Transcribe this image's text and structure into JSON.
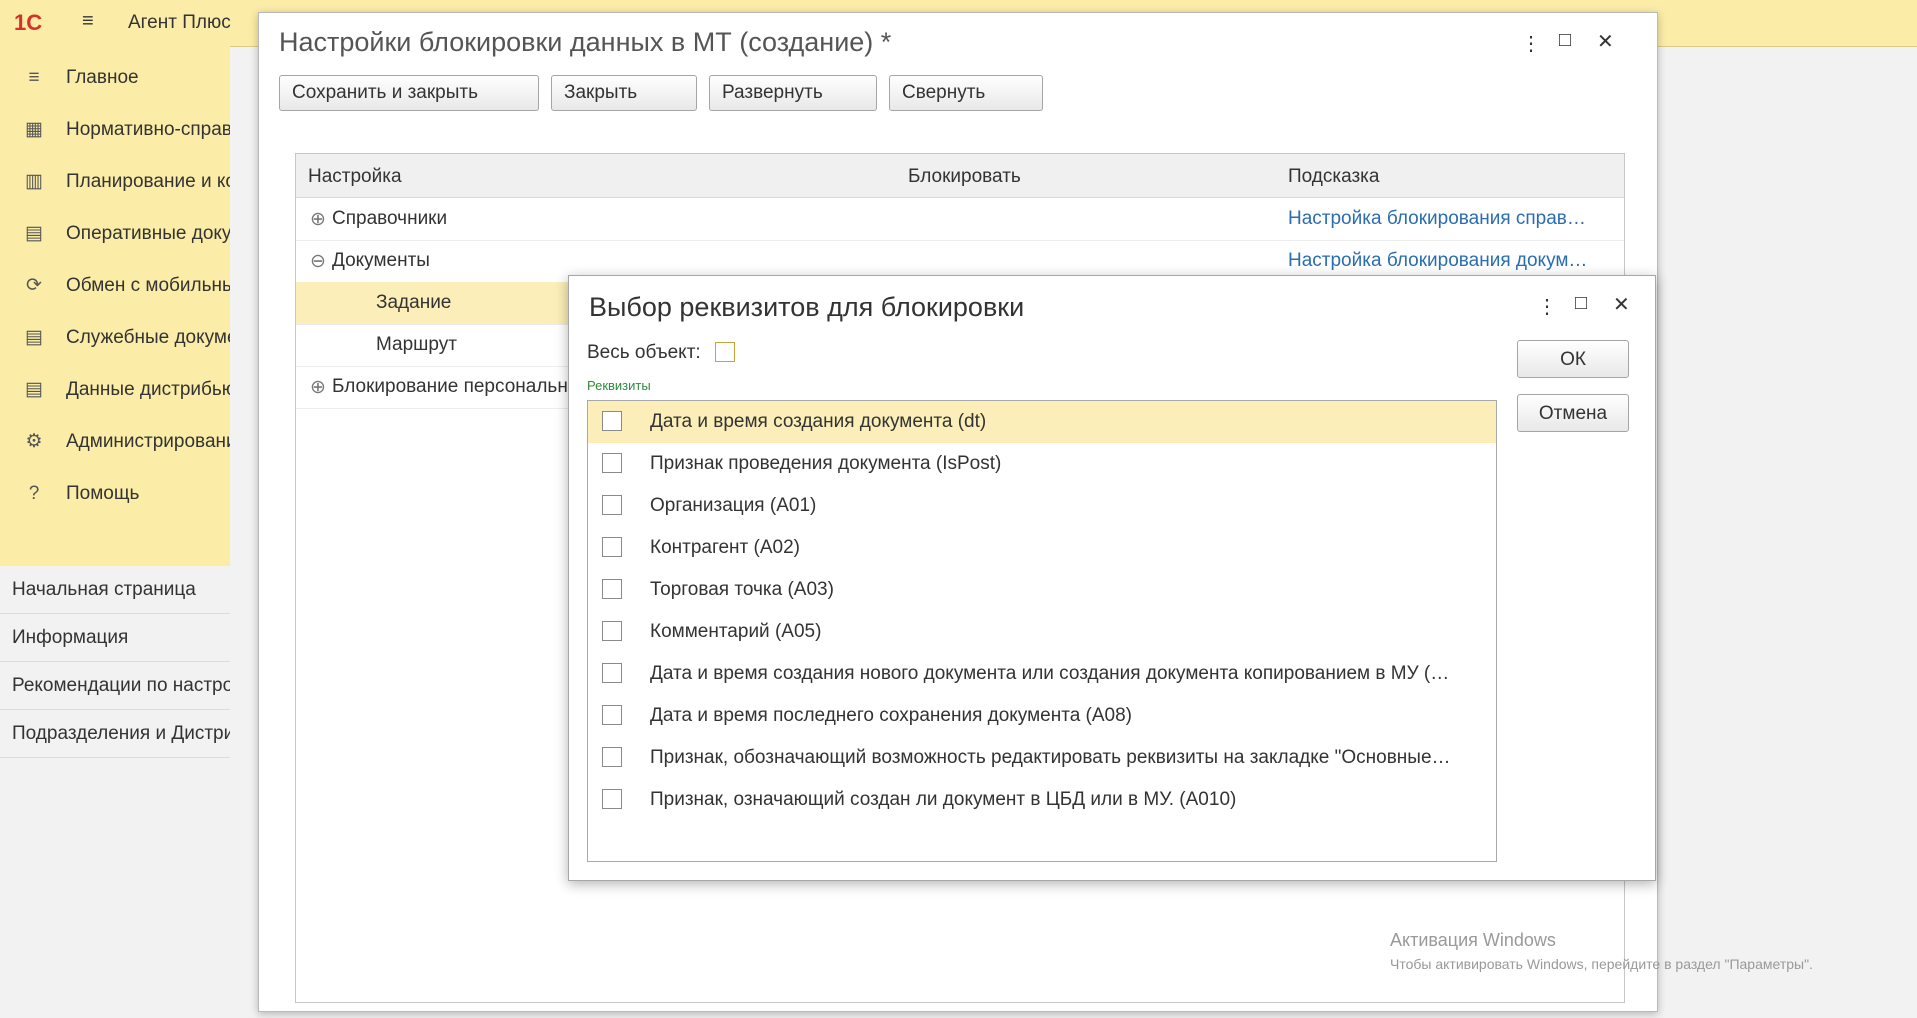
{
  "app": {
    "logo": "1С",
    "title": "Агент Плюс"
  },
  "sidebar": [
    {
      "icon": "menu-lines-icon",
      "glyph": "≡",
      "label": "Главное"
    },
    {
      "icon": "table-icon",
      "glyph": "▦",
      "label": "Нормативно-справочная информация"
    },
    {
      "icon": "bar-chart-icon",
      "glyph": "▥",
      "label": "Планирование и контроль"
    },
    {
      "icon": "documents-icon",
      "glyph": "▤",
      "label": "Оперативные документы"
    },
    {
      "icon": "sync-icon",
      "glyph": "⟳",
      "label": "Обмен с мобильными устройствами"
    },
    {
      "icon": "service-docs-icon",
      "glyph": "▤",
      "label": "Служебные документы"
    },
    {
      "icon": "distributor-data-icon",
      "glyph": "▤",
      "label": "Данные дистрибьютора"
    },
    {
      "icon": "gear-icon",
      "glyph": "⚙",
      "label": "Администрирование"
    },
    {
      "icon": "help-icon",
      "glyph": "?",
      "label": "Помощь"
    }
  ],
  "opened": [
    "Начальная страница",
    "Информация",
    "Рекомендации по настройке",
    "Подразделения и Дистрибьюторы"
  ],
  "window": {
    "title": "Настройки блокировки данных в МТ (создание) *",
    "buttons": [
      "Сохранить и закрыть",
      "Закрыть",
      "Развернуть",
      "Свернуть"
    ],
    "columns": [
      "Настройка",
      "Блокировать",
      "Подсказка"
    ],
    "rows": [
      {
        "expander": "⊕",
        "label": "Справочники",
        "hint": "Настройка блокирования справ…"
      },
      {
        "expander": "⊖",
        "label": "Документы",
        "hint": "Настройка блокирования докум…"
      },
      {
        "expander": "",
        "label": "Задание",
        "hint": ""
      },
      {
        "expander": "",
        "label": "Маршрут",
        "hint": ""
      },
      {
        "expander": "⊕",
        "label": "Блокирование персональных данных",
        "hint": ""
      }
    ]
  },
  "dialog": {
    "title": "Выбор реквизитов для блокировки",
    "whole_object_label": "Весь объект:",
    "section_label": "Реквизиты",
    "ok": "ОК",
    "cancel": "Отмена",
    "items": [
      "Дата и время создания документа (dt)",
      "Признак проведения документа (IsPost)",
      "Организация (A01)",
      "Контрагент (A02)",
      "Торговая точка (A03)",
      "Комментарий (A05)",
      "Дата и время создания нового документа или создания документа копированием в МУ (…",
      "Дата и время последнего сохранения документа (A08)",
      "Признак, обозначающий возможность редактировать реквизиты на закладке \"Основные…",
      "Признак, означающий создан ли документ в ЦБД или в МУ. (A010)"
    ]
  },
  "watermark": {
    "title": "Активация Windows",
    "text": "Чтобы активировать Windows, перейдите в раздел \"Параметры\"."
  }
}
